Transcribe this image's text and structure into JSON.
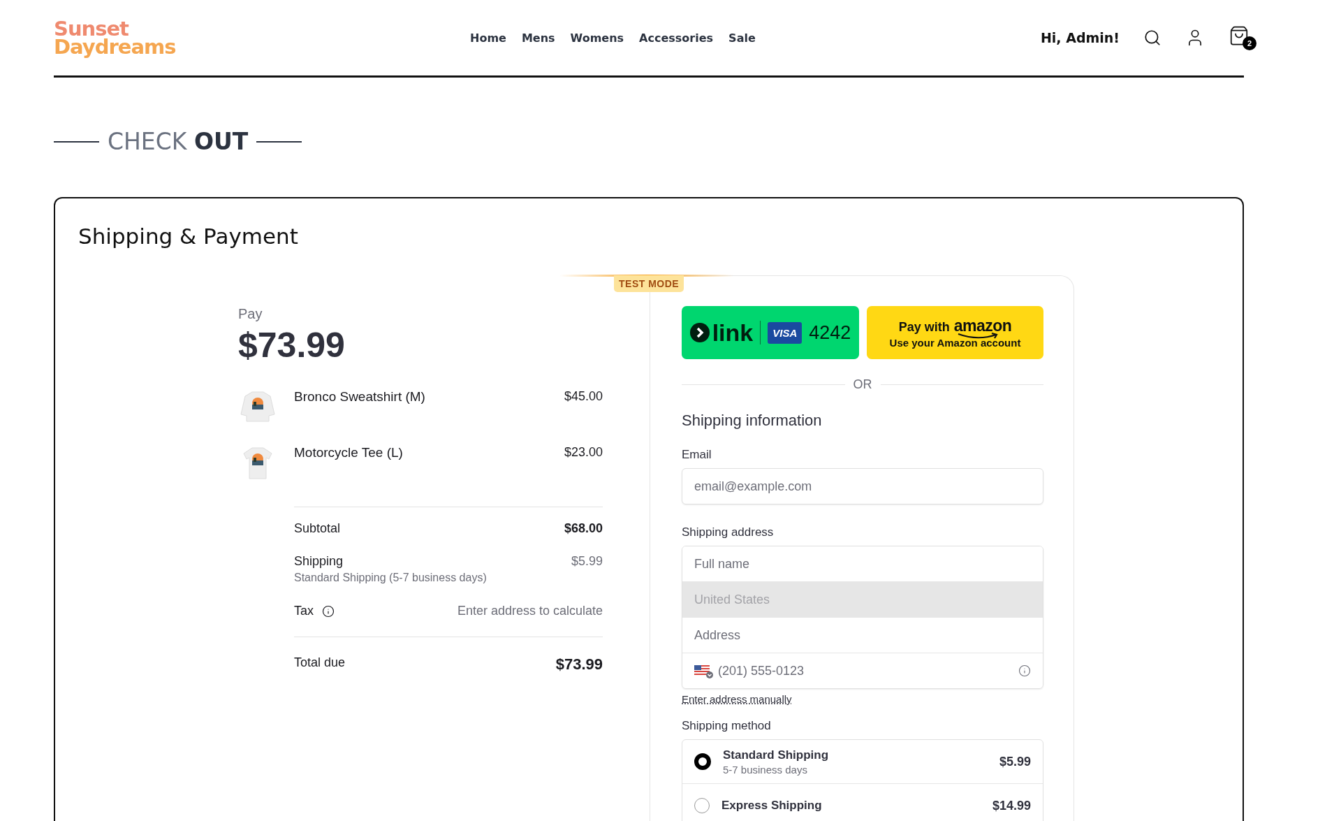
{
  "header": {
    "logo": [
      "Sunset",
      "Daydreams"
    ],
    "nav": [
      {
        "label": "Home"
      },
      {
        "label": "Mens"
      },
      {
        "label": "Womens"
      },
      {
        "label": "Accessories"
      },
      {
        "label": "Sale"
      }
    ],
    "greeting": "Hi, Admin!",
    "cart_count": "2"
  },
  "page_title": [
    {
      "text": "CHECK",
      "bold": false
    },
    {
      "text": "OUT",
      "bold": true
    }
  ],
  "card": {
    "title": "Shipping & Payment"
  },
  "summary": {
    "pay_label": "Pay",
    "amount": "$73.99",
    "items": [
      {
        "name": "Bronco Sweatshirt (M)",
        "price": "$45.00",
        "kind": "picture"
      },
      {
        "name": "Motorcycle Tee (L)",
        "price": "$23.00",
        "kind": "picture"
      }
    ],
    "subtotal": {
      "label": "Subtotal",
      "value": "$68.00"
    },
    "shipping": {
      "label": "Shipping",
      "detail": "Standard Shipping (5-7 business days)",
      "value": "$5.99"
    },
    "tax": {
      "label": "Tax",
      "value": "Enter address to calculate"
    },
    "total": {
      "label": "Total due",
      "value": "$73.99"
    }
  },
  "payment": {
    "test_mode": "TEST MODE",
    "link": {
      "word": "link",
      "card_brand": "VISA",
      "last4": "4242"
    },
    "amazon": {
      "line1": "Pay with",
      "brand": "amazon",
      "line2": "Use your Amazon account"
    },
    "or": "OR",
    "section_title": "Shipping information",
    "email": {
      "label": "Email",
      "placeholder": "email@example.com"
    },
    "address": {
      "label": "Shipping address",
      "fields": [
        {
          "kind": "text",
          "placeholder": "Full name",
          "disabled": false
        },
        {
          "kind": "select",
          "placeholder": "United States",
          "disabled": true
        },
        {
          "kind": "text",
          "placeholder": "Address",
          "disabled": false
        },
        {
          "kind": "phone",
          "placeholder": "(201) 555-0123",
          "disabled": false
        }
      ]
    },
    "manual_link": "Enter address manually",
    "shipping_method": {
      "label": "Shipping method",
      "options": [
        {
          "name": "Standard Shipping",
          "detail": "5-7 business days",
          "price": "$5.99",
          "selected": true
        },
        {
          "name": "Express Shipping",
          "price": "$14.99",
          "selected": false
        }
      ]
    }
  }
}
